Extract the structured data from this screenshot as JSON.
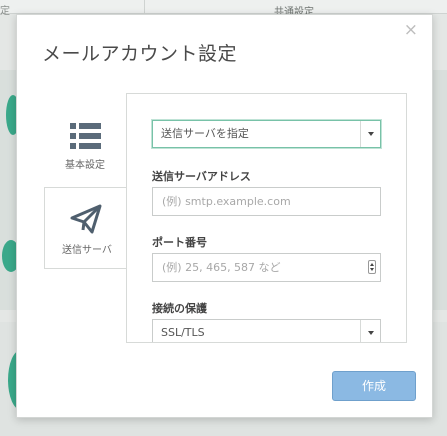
{
  "background": {
    "top_left_text": "定",
    "top_text": "共通設定"
  },
  "dialog": {
    "title": "メールアカウント設定",
    "close_symbol": "×"
  },
  "tabs": [
    {
      "label": "基本設定",
      "icon": "list-icon",
      "active": false
    },
    {
      "label": "送信サーバ",
      "icon": "paper-plane-icon",
      "active": true
    }
  ],
  "form": {
    "server_mode": {
      "selected": "送信サーバを指定"
    },
    "server_address": {
      "label": "送信サーバアドレス",
      "value": "",
      "placeholder": "(例) smtp.example.com"
    },
    "port": {
      "label": "ポート番号",
      "value": "",
      "placeholder": "(例) 25, 465, 587 など"
    },
    "security": {
      "label": "接続の保護",
      "selected": "SSL/TLS"
    }
  },
  "footer": {
    "create_label": "作成"
  },
  "colors": {
    "accent_border": "#78c2a8",
    "primary_button": "#8bb9e3",
    "backdrop_accent": "#3aa88a"
  }
}
